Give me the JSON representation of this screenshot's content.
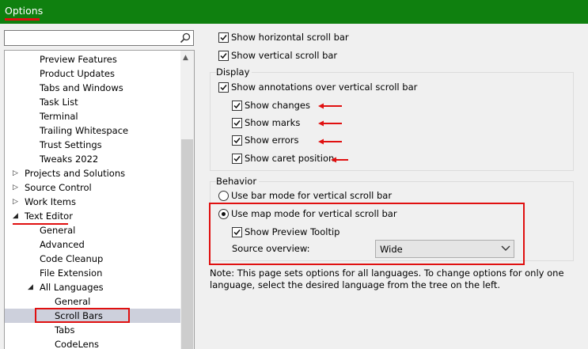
{
  "window": {
    "title": "Options"
  },
  "search": {
    "placeholder": ""
  },
  "tree": {
    "items": [
      {
        "label": "Preview Features",
        "level": 2
      },
      {
        "label": "Product Updates",
        "level": 2
      },
      {
        "label": "Tabs and Windows",
        "level": 2
      },
      {
        "label": "Task List",
        "level": 2
      },
      {
        "label": "Terminal",
        "level": 2
      },
      {
        "label": "Trailing Whitespace",
        "level": 2
      },
      {
        "label": "Trust Settings",
        "level": 2
      },
      {
        "label": "Tweaks 2022",
        "level": 2
      },
      {
        "label": "Projects and Solutions",
        "level": 1,
        "expander": "collapsed"
      },
      {
        "label": "Source Control",
        "level": 1,
        "expander": "collapsed"
      },
      {
        "label": "Work Items",
        "level": 1,
        "expander": "collapsed"
      },
      {
        "label": "Text Editor",
        "level": 1,
        "expander": "expanded"
      },
      {
        "label": "General",
        "level": 2
      },
      {
        "label": "Advanced",
        "level": 2
      },
      {
        "label": "Code Cleanup",
        "level": 2
      },
      {
        "label": "File Extension",
        "level": 2
      },
      {
        "label": "All Languages",
        "level": 2,
        "expander": "expanded"
      },
      {
        "label": "General",
        "level": 3
      },
      {
        "label": "Scroll Bars",
        "level": 3,
        "selected": true
      },
      {
        "label": "Tabs",
        "level": 3
      },
      {
        "label": "CodeLens",
        "level": 3
      }
    ]
  },
  "options": {
    "show_horizontal": {
      "label": "Show horizontal scroll bar",
      "checked": true
    },
    "show_vertical": {
      "label": "Show vertical scroll bar",
      "checked": true
    },
    "display": {
      "title": "Display",
      "annotations": {
        "label": "Show annotations over vertical scroll bar",
        "checked": true
      },
      "changes": {
        "label": "Show changes",
        "checked": true
      },
      "marks": {
        "label": "Show marks",
        "checked": true
      },
      "errors": {
        "label": "Show errors",
        "checked": true
      },
      "caret": {
        "label": "Show caret position",
        "checked": true
      }
    },
    "behavior": {
      "title": "Behavior",
      "bar_mode": {
        "label": "Use bar mode for vertical scroll bar",
        "selected": false
      },
      "map_mode": {
        "label": "Use map mode for vertical scroll bar",
        "selected": true
      },
      "preview_tooltip": {
        "label": "Show Preview Tooltip",
        "checked": true
      },
      "source_overview": {
        "label": "Source overview:",
        "value": "Wide"
      }
    },
    "note": "Note: This page sets options for all languages. To change options for only one language, select the desired language from the tree on the left."
  },
  "colors": {
    "titlebar": "#0f800f",
    "annotation_red": "#e01010",
    "selection": "#cdd0dc"
  }
}
